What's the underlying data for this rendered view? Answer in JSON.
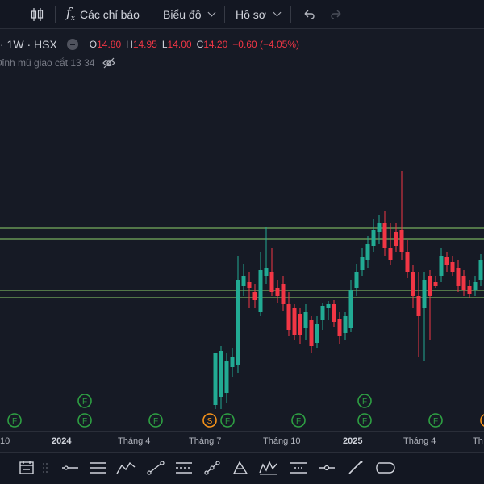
{
  "toolbar": {
    "indicators_label": "Các chỉ báo",
    "chart_label": "Biểu đồ",
    "profile_label": "Hồ sơ"
  },
  "legend": {
    "symbol": "· 1W · HSX",
    "ohlc": {
      "o_key": "O",
      "o_val": "14.80",
      "h_key": "H",
      "h_val": "14.95",
      "l_key": "L",
      "l_val": "14.00",
      "c_key": "C",
      "c_val": "14.20",
      "change": "−0.60 (−4.05%)"
    },
    "indicator": "Đỉnh mũ giao cắt 13 34"
  },
  "xaxis": {
    "labels": [
      "10",
      "2024",
      "Tháng 4",
      "Tháng 7",
      "Tháng 10",
      "2025",
      "Tháng 4",
      "Th"
    ]
  },
  "markers": {
    "f": "F",
    "s": "S"
  },
  "colors": {
    "up": "#22ab94",
    "down": "#f23645",
    "level_lines": "#8fd16a",
    "marker_green": "#2ea043",
    "marker_orange": "#f7931a"
  },
  "chart_data": {
    "type": "candlestick",
    "timeframe": "1W",
    "exchange": "HSX",
    "last_bar": {
      "open": 14.8,
      "high": 14.95,
      "low": 14.0,
      "close": 14.2,
      "change": -0.6,
      "change_pct": -4.05
    }
  }
}
